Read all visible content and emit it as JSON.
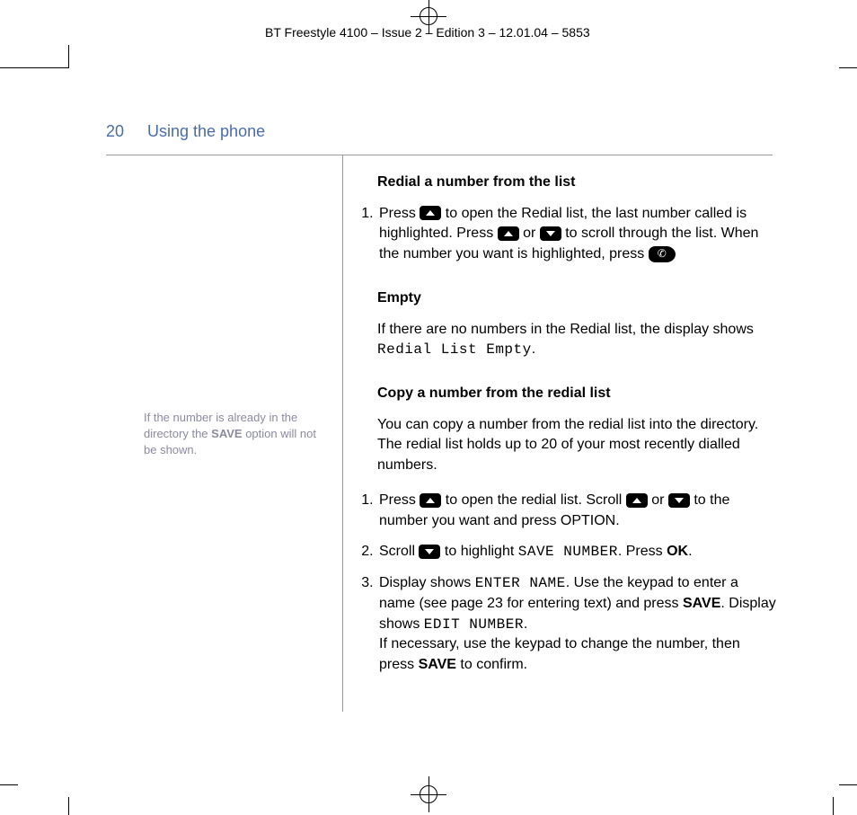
{
  "header": {
    "running_head": "BT Freestyle 4100 – Issue 2 – Edition 3 – 12.01.04 – 5853",
    "page_number": "20",
    "section_title": "Using the phone"
  },
  "sidebar": {
    "note_prefix": "If the number is already in the directory the ",
    "note_bold": "SAVE",
    "note_suffix": " option will not be shown."
  },
  "content": {
    "redial": {
      "heading": "Redial a number from the list",
      "step1_a": "Press ",
      "step1_b": " to open the Redial list, the last number called is highlighted. Press ",
      "step1_c": " or ",
      "step1_d": " to scroll through the list. When the number you want is highlighted, press "
    },
    "empty": {
      "heading": "Empty",
      "body_a": "If there are no numbers in the Redial list, the display shows ",
      "lcd": "Redial List Empty",
      "body_b": "."
    },
    "copy": {
      "heading": "Copy a number from the redial list",
      "intro": "You can copy a number from the redial list into the directory. The redial list holds up to 20 of your most recently dialled numbers.",
      "step1_a": "Press ",
      "step1_b": " to open the redial list. Scroll ",
      "step1_c": " or ",
      "step1_d": " to the number you want and press OPTION.",
      "step2_a": "Scroll ",
      "step2_b": " to highlight ",
      "step2_lcd": "SAVE NUMBER",
      "step2_c": ". Press ",
      "step2_ok": "OK",
      "step2_d": ".",
      "step3_a": "Display shows ",
      "step3_lcd1": "ENTER NAME",
      "step3_b": ". Use the keypad to enter a name (see page 23 for entering text) and press ",
      "step3_save1": "SAVE",
      "step3_c": ". Display shows ",
      "step3_lcd2": "EDIT NUMBER",
      "step3_d": ".",
      "step3_e": "If necessary, use the keypad to change the number, then press ",
      "step3_save2": "SAVE",
      "step3_f": " to confirm."
    }
  }
}
